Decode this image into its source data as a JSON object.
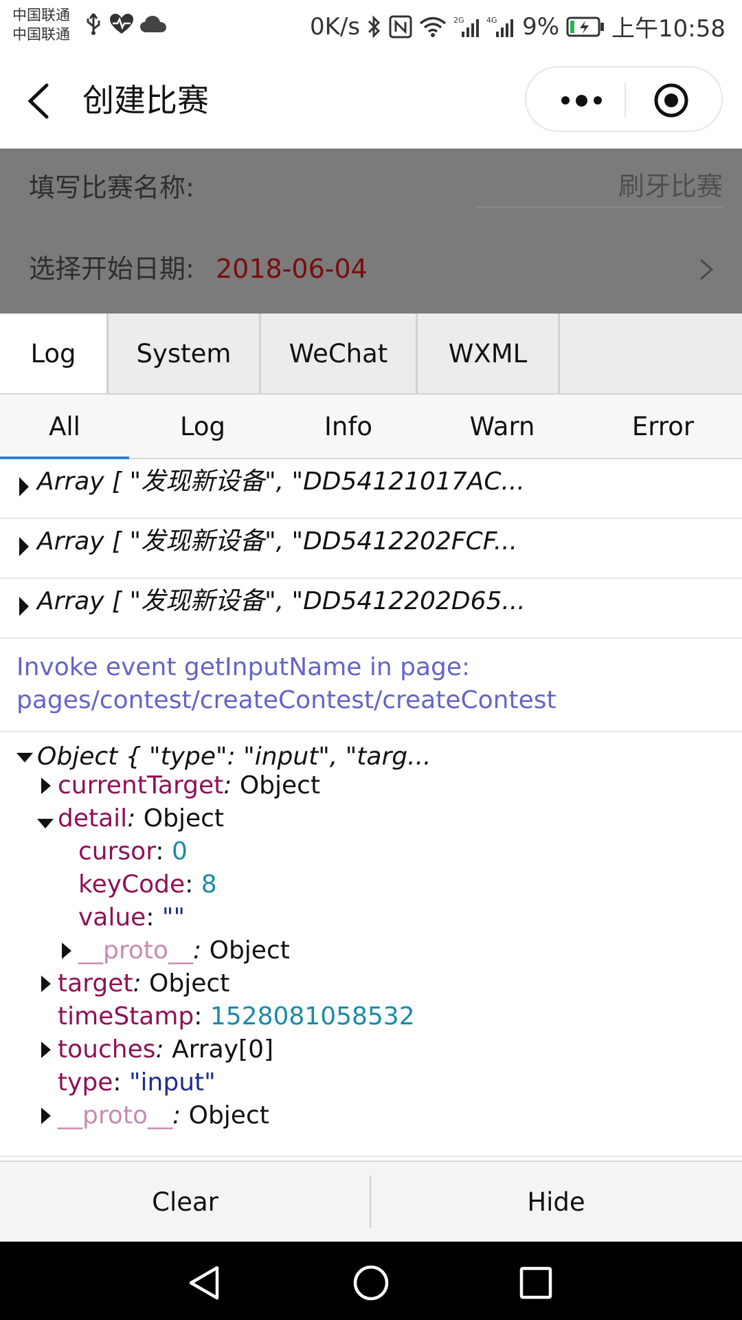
{
  "status_bar": {
    "carrier_1": "中国联通",
    "carrier_2": "中国联通",
    "net_speed": "0K/s",
    "signal_1_type": "2G",
    "signal_2_type": "4G",
    "battery": "9%",
    "time": "上午10:58"
  },
  "nav": {
    "title": "创建比赛"
  },
  "form": {
    "name_label": "填写比赛名称:",
    "name_placeholder": "刷牙比赛",
    "date_label": "选择开始日期:",
    "date_value": "2018-06-04"
  },
  "console": {
    "tabs": [
      "Log",
      "System",
      "WeChat",
      "WXML"
    ],
    "active_tab": "Log",
    "subtabs": [
      "All",
      "Log",
      "Info",
      "Warn",
      "Error"
    ],
    "active_subtab": "All",
    "logs": {
      "array_1": "Array [ \"发现新设备\", \"DD54121017AC...",
      "array_2": "Array [ \"发现新设备\", \"DD5412202FCF...",
      "array_3": "Array [ \"发现新设备\", \"DD5412202D65...",
      "info_line_1": "Invoke event getInputName in page:",
      "info_line_2": "pages/contest/createContest/createContest",
      "object_summary": "Object { \"type\": \"input\", \"targ...",
      "tree": {
        "current_target_key": "currentTarget",
        "current_target_val": "Object",
        "detail_key": "detail",
        "detail_val": "Object",
        "cursor_key": "cursor",
        "cursor_val": "0",
        "keycode_key": "keyCode",
        "keycode_val": "8",
        "value_key": "value",
        "value_val": "\"\"",
        "detail_proto_key": "__proto__",
        "detail_proto_val": "Object",
        "target_key": "target",
        "target_val": "Object",
        "timestamp_key": "timeStamp",
        "timestamp_val": "1528081058532",
        "touches_key": "touches",
        "touches_val": "Array[0]",
        "type_key": "type",
        "type_val": "\"input\"",
        "proto_key": "__proto__",
        "proto_val": "Object"
      }
    },
    "toolbar": {
      "clear": "Clear",
      "hide": "Hide"
    }
  },
  "colors": {
    "accent_blue": "#2f7fd1",
    "info_text": "#6464c8",
    "key_color": "#8e1155",
    "number_color": "#1b8aa6",
    "string_color": "#1e2d8c",
    "date_color": "#7a0d0d"
  }
}
